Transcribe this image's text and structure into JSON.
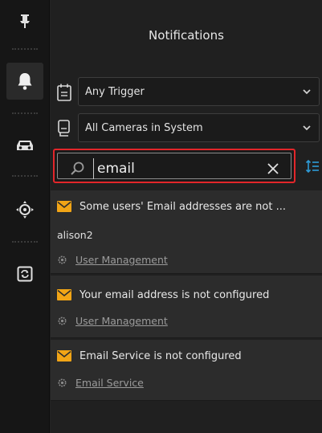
{
  "panel": {
    "title": "Notifications"
  },
  "filters": {
    "trigger": {
      "selected": "Any Trigger",
      "icon": "calendar-icon"
    },
    "cameras": {
      "selected": "All Cameras in System",
      "icon": "camera-icon"
    }
  },
  "search": {
    "value": "email",
    "placeholder": ""
  },
  "notifications": [
    {
      "message": "Some users' Email addresses are not ...",
      "detail": "alison2",
      "link": "User Management"
    },
    {
      "message": "Your email address is not configured",
      "link": "User Management"
    },
    {
      "message": "Email Service is not configured",
      "link": "Email Service"
    }
  ],
  "colors": {
    "accent_warning": "#f2a516",
    "search_highlight": "#e3262a",
    "rail_bg": "#161616",
    "panel_bg": "#202020"
  },
  "rail_icons": [
    "pin-icon",
    "bell-icon",
    "car-icon",
    "crosshair-icon",
    "screen-refresh-icon"
  ]
}
